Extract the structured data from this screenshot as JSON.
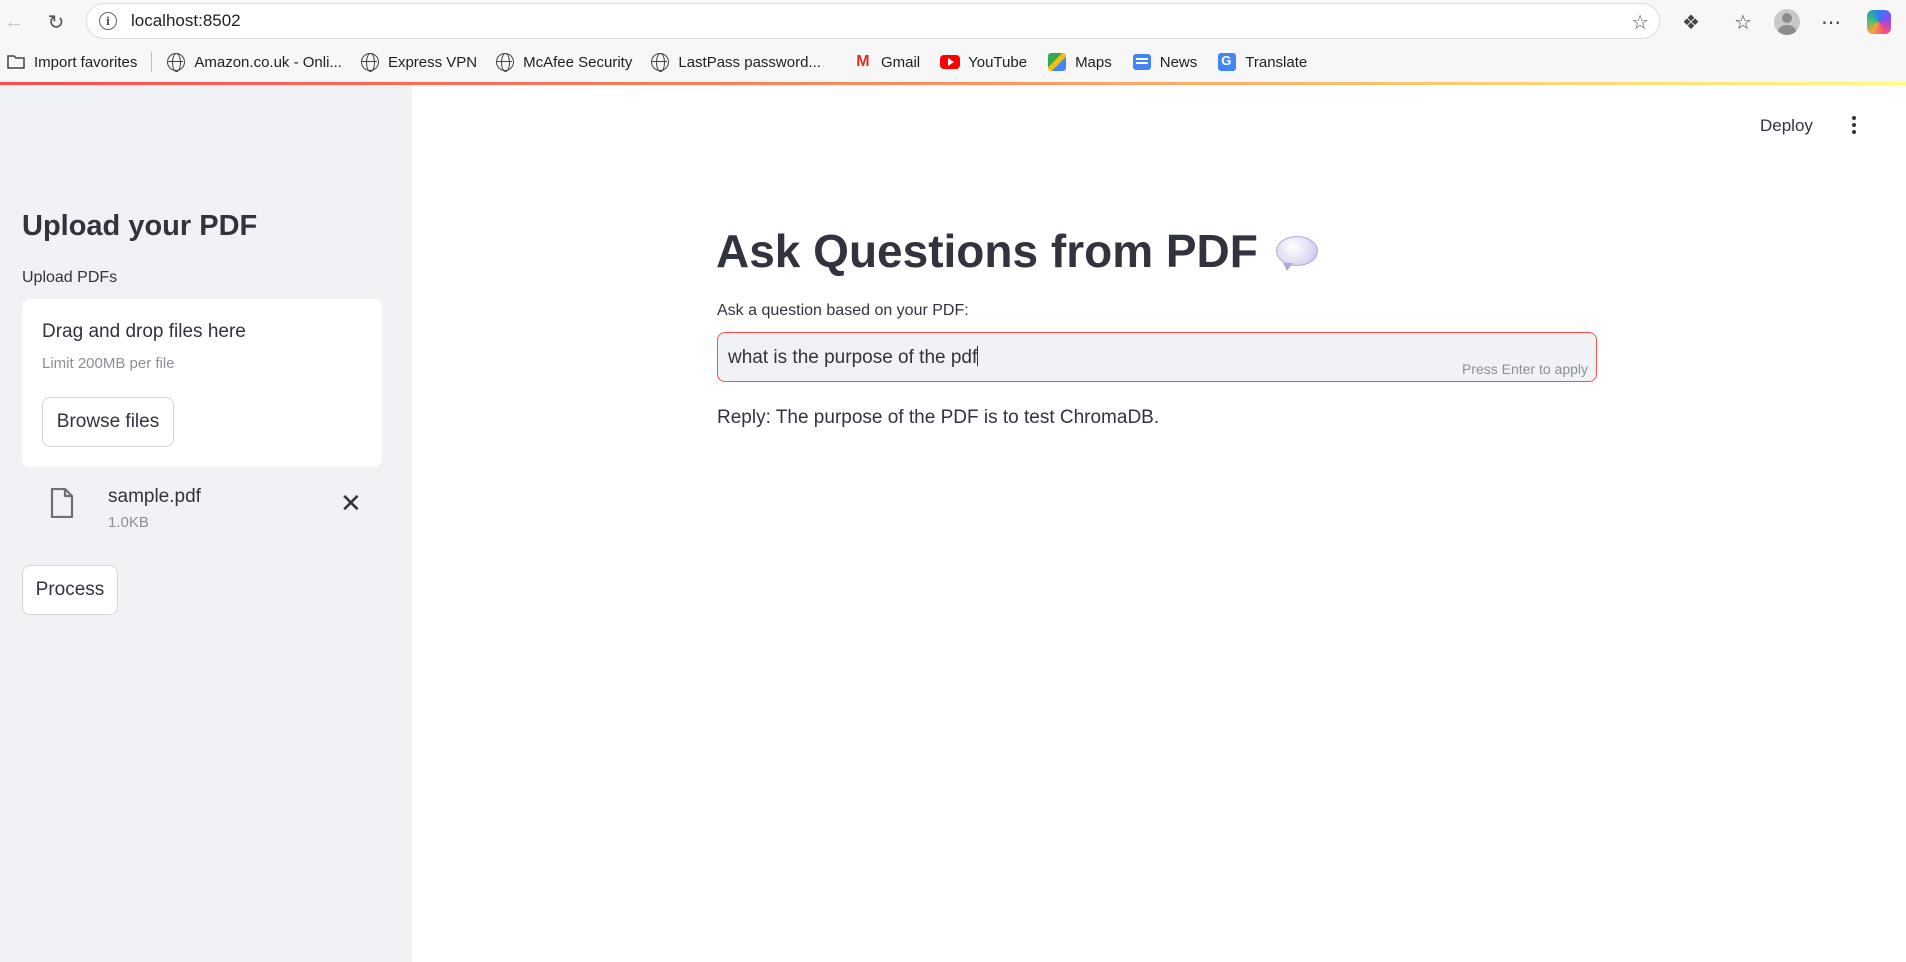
{
  "browser": {
    "url": "localhost:8502",
    "bookmarks": [
      {
        "label": "Import favorites",
        "icon": "folder-import-icon"
      },
      {
        "label": "Amazon.co.uk - Onli...",
        "icon": "globe-icon"
      },
      {
        "label": "Express VPN",
        "icon": "globe-icon"
      },
      {
        "label": "McAfee Security",
        "icon": "globe-icon"
      },
      {
        "label": "LastPass password...",
        "icon": "globe-icon"
      },
      {
        "label": "Gmail",
        "icon": "gmail-icon"
      },
      {
        "label": "YouTube",
        "icon": "youtube-icon"
      },
      {
        "label": "Maps",
        "icon": "maps-icon"
      },
      {
        "label": "News",
        "icon": "news-icon"
      },
      {
        "label": "Translate",
        "icon": "translate-icon"
      }
    ]
  },
  "sidebar": {
    "title": "Upload your PDF",
    "uploader_label": "Upload PDFs",
    "dropzone_title": "Drag and drop files here",
    "dropzone_limit": "Limit 200MB per file",
    "browse_label": "Browse files",
    "file": {
      "name": "sample.pdf",
      "size": "1.0KB"
    },
    "process_label": "Process"
  },
  "header": {
    "deploy_label": "Deploy"
  },
  "main": {
    "title": "Ask Questions from PDF",
    "question_label": "Ask a question based on your PDF:",
    "question_value": "what is the purpose of the pdf",
    "input_hint": "Press Enter to apply",
    "reply": "Reply: The purpose of the PDF is to test ChromaDB."
  },
  "colors": {
    "accent": "#ff4b4b",
    "sidebar_bg": "#f0f2f6",
    "text": "#31333f"
  }
}
